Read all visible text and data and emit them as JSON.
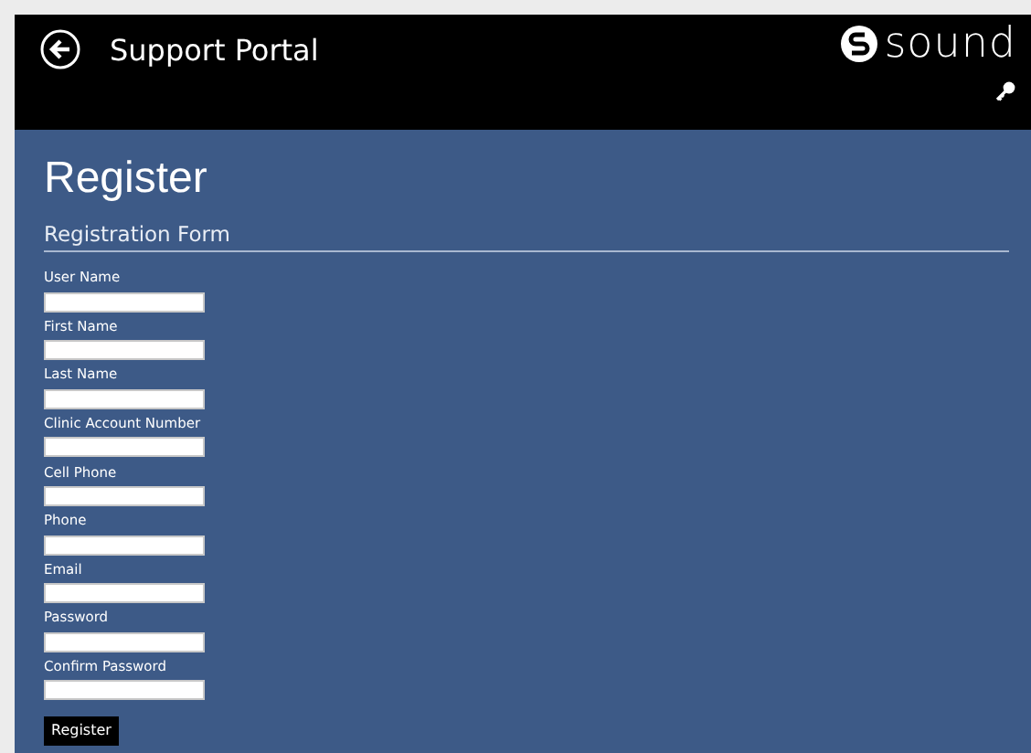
{
  "header": {
    "title": "Support Portal",
    "logo": "sound"
  },
  "page": {
    "title": "Register",
    "section": "Registration Form"
  },
  "fields": [
    {
      "label": "User Name"
    },
    {
      "label": "First Name"
    },
    {
      "label": "Last Name"
    },
    {
      "label": "Clinic Account Number"
    },
    {
      "label": "Cell Phone"
    },
    {
      "label": "Phone"
    },
    {
      "label": "Email"
    },
    {
      "label": "Password"
    },
    {
      "label": "Confirm Password"
    }
  ],
  "submit": "Register"
}
